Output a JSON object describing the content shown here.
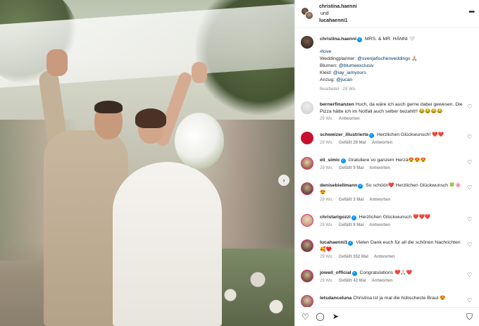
{
  "post": {
    "carousel_next": "›"
  },
  "header": {
    "user1": "christina.haenni",
    "connector": "und",
    "user2": "lucahaenni1",
    "more": "•••"
  },
  "caption": {
    "username": "christina.haenni",
    "text": "MRS. & MR. HÄNNI 🤍",
    "hashtag": "#love",
    "planner_label": "Weddingplanner:",
    "planner_tag": "@svenjafischerweddings",
    "planner_emoji": "🙏🏼",
    "flowers_label": "Blumen:",
    "flowers_tag": "@blumeexclusiv",
    "dress_label": "Kleid:",
    "dress_tag": "@iay_iamyours",
    "suit_label": "Anzug:",
    "suit_tag": "@jucan",
    "edited": "Bearbeitet · 29 Wo."
  },
  "comments": [
    {
      "user": "bernerfinanzen",
      "verified": false,
      "text": "Huch, da wäre ich auch gerne dabei gewesen. Die Pizza hätte ich im Notfall auch selber bezahlt!! 😂😂😂😂",
      "age": "29 Wo.",
      "likes": "",
      "reply": "Antworten"
    },
    {
      "user": "schweizer_illustrierte",
      "verified": true,
      "text": "Herzlichen Glückwunsch! ❤️❤️",
      "age": "29 Wo.",
      "likes": "Gefällt 29 Mal",
      "reply": "Antworten"
    },
    {
      "user": "eli_simic",
      "verified": true,
      "text": "Gratuliere vo ganzem Herzä😍😍😍",
      "age": "29 Wo.",
      "likes": "Gefällt 9 Mal",
      "reply": "Antworten"
    },
    {
      "user": "denisebiellmann",
      "verified": true,
      "text": "So schöön❤️ Herzlichen Glückwunsch 🍀🌸😍",
      "age": "29 Wo.",
      "likes": "Gefällt 3 Mal",
      "reply": "Antworten"
    },
    {
      "user": "christarigozzi",
      "verified": true,
      "text": "Herzlichen Glückwunsch ❤️❤️❤️",
      "age": "29 Wo.",
      "likes": "Gefällt 9 Mal",
      "reply": "Antworten"
    },
    {
      "user": "lucahaenni1",
      "verified": true,
      "text": "Vielen Dank euch für all die schönen Nachrichten🥰♥️",
      "age": "29 Wo.",
      "likes": "Gefällt 352 Mal",
      "reply": "Antworten"
    },
    {
      "user": "joweil_official",
      "verified": true,
      "text": "Congratulations ❤️🙏🏻❤️",
      "age": "29 Wo.",
      "likes": "Gefällt 42 Mal",
      "reply": "Antworten"
    },
    {
      "user": "letsdanceluna",
      "verified": false,
      "text": "Christina ist ja mal die hübscheste Braut 😍",
      "age": "",
      "likes": "",
      "reply": ""
    }
  ],
  "footer": {
    "like_icon": "♡",
    "comment_icon": "◯",
    "share_icon": "➤",
    "save_icon": "⛉"
  }
}
